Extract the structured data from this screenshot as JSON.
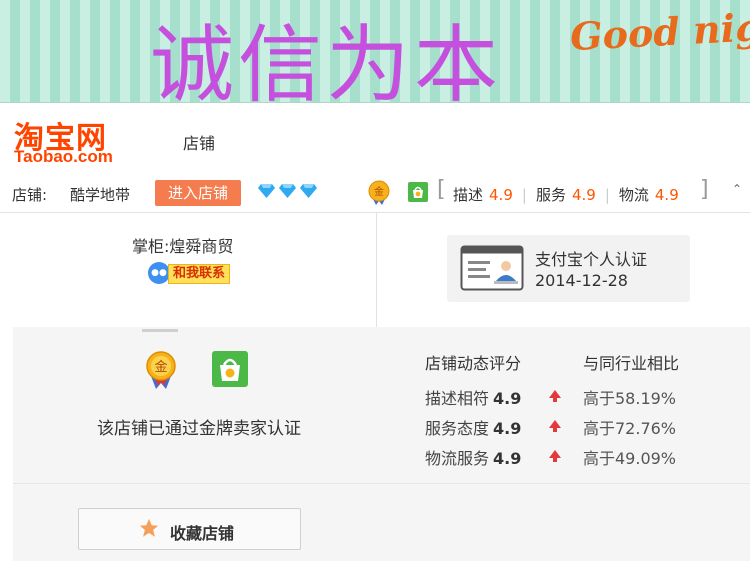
{
  "banner": {
    "title": "诚信为本",
    "greeting": "Good night"
  },
  "header": {
    "logo_zh": "淘宝网",
    "logo_en": "Taobao.com",
    "nav_label": "店铺"
  },
  "shop_bar": {
    "shop_label": "店铺:",
    "shop_name": "酷学地带",
    "enter_button": "进入店铺",
    "diamond_count": 3,
    "ratings": [
      {
        "label": "描述",
        "value": "4.9"
      },
      {
        "label": "服务",
        "value": "4.9"
      },
      {
        "label": "物流",
        "value": "4.9"
      }
    ],
    "bracket_open": "[",
    "bracket_close": "]"
  },
  "seller": {
    "keeper": "掌柜:煌舜商贸",
    "contact_label": "和我联系"
  },
  "certification": {
    "title": "支付宝个人认证",
    "date": "2014-12-28"
  },
  "gold_seller": {
    "text": "该店铺已通过金牌卖家认证"
  },
  "dynamic_ratings": {
    "title": "店铺动态评分",
    "compare_title": "与同行业相比",
    "rows": [
      {
        "label": "描述相符",
        "score": "4.9",
        "compare": "高于58.19%"
      },
      {
        "label": "服务态度",
        "score": "4.9",
        "compare": "高于72.76%"
      },
      {
        "label": "物流服务",
        "score": "4.9",
        "compare": "高于49.09%"
      }
    ]
  },
  "favorite": {
    "label": "收藏店铺"
  },
  "colors": {
    "brand": "#ff4400",
    "accent_button": "#f47c4e",
    "banner_text": "#c450dd",
    "rating_value": "#ff5500",
    "up_arrow": "#e4393c"
  }
}
